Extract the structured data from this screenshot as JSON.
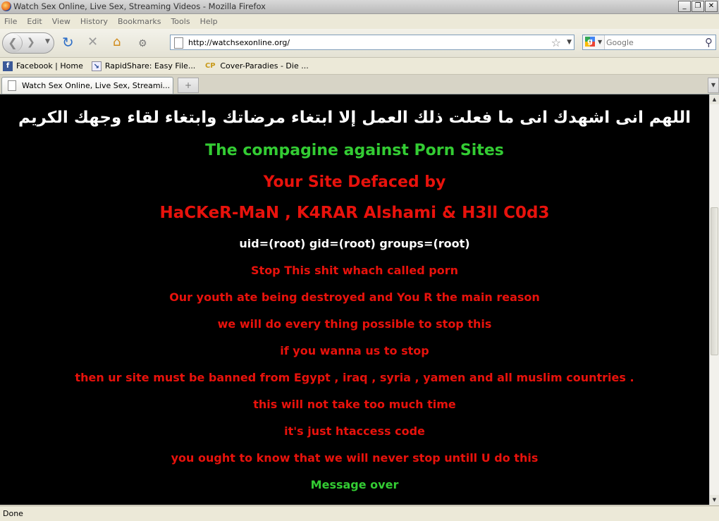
{
  "window": {
    "title": "Watch Sex Online, Live Sex, Streaming Videos - Mozilla Firefox",
    "controls": {
      "minimize": "_",
      "maximize": "❐",
      "close": "✕"
    }
  },
  "menu": [
    "File",
    "Edit",
    "View",
    "History",
    "Bookmarks",
    "Tools",
    "Help"
  ],
  "nav": {
    "url": "http://watchsexonline.org/",
    "search_placeholder": "Google"
  },
  "bookmarks": [
    {
      "label": "Facebook | Home",
      "icon": "facebook-icon"
    },
    {
      "label": "RapidShare: Easy File...",
      "icon": "rapidshare-icon"
    },
    {
      "label": "Cover-Paradies - Die ...",
      "icon": "cp-icon"
    }
  ],
  "tabs": [
    {
      "label": "Watch Sex Online, Live Sex, Streami..."
    }
  ],
  "page": {
    "colors": {
      "background": "#000000",
      "white": "#ffffff",
      "green": "#33cc33",
      "red": "#e8120c"
    },
    "arabic_line": "اللهم انى اشهدك انى ما فعلت ذلك العمل إلا ابتغاء مرضاتك وابتغاء لقاء وجهك الكريم",
    "campaign": "The compagine against Porn Sites",
    "defaced_by": "Your Site Defaced by",
    "hackers": "HaCKeR-MaN , K4RAR Alshami & H3ll C0d3",
    "uid": "uid=(root) gid=(root) groups=(root)",
    "messages": [
      "Stop This shit whach called porn",
      "Our youth ate being destroyed and You R the main reason",
      "we will do every thing possible to stop this",
      "if you wanna us to stop",
      "then ur site must be banned from Egypt , iraq , syria , yamen and all muslim countries .",
      "this will not take too much time",
      "it's just htaccess code",
      "you ought to know that we will never stop untill U do this"
    ],
    "message_over": "Message over"
  },
  "status": {
    "text": "Done"
  }
}
